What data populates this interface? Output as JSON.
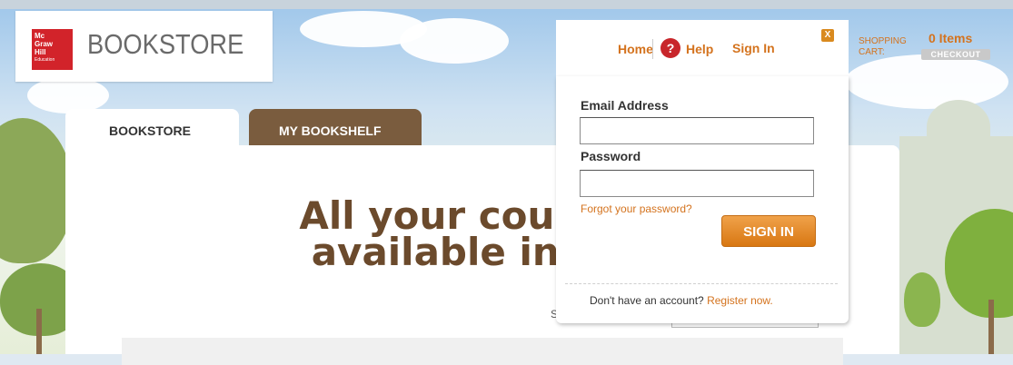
{
  "brand": {
    "badge_lines": [
      "Mc",
      "Graw",
      "Hill",
      "Education"
    ],
    "title": "BOOKSTORE"
  },
  "nav": {
    "home": "Home",
    "help_icon": "?",
    "help": "Help",
    "sign_in": "Sign In",
    "close": "X"
  },
  "cart": {
    "label_line1": "SHOPPING",
    "label_line2": "CART:",
    "items": "0 Items",
    "checkout": "CHECKOUT"
  },
  "tabs": [
    {
      "label": "BOOKSTORE"
    },
    {
      "label": "MY BOOKSHELF"
    }
  ],
  "hero": {
    "line1": "All your course",
    "line2": "available in o"
  },
  "search": {
    "hint": "S"
  },
  "signin_form": {
    "email_label": "Email Address",
    "email_value": "",
    "password_label": "Password",
    "password_value": "",
    "forgot": "Forgot your password?",
    "submit": "SIGN IN",
    "register_prompt": "Don't have an account?",
    "register_link": "Register now."
  },
  "colors": {
    "accent_orange": "#d4731e",
    "brand_red": "#d2232a",
    "tab_brown": "#7a5c3e",
    "headline_brown": "#6b4a2c"
  }
}
